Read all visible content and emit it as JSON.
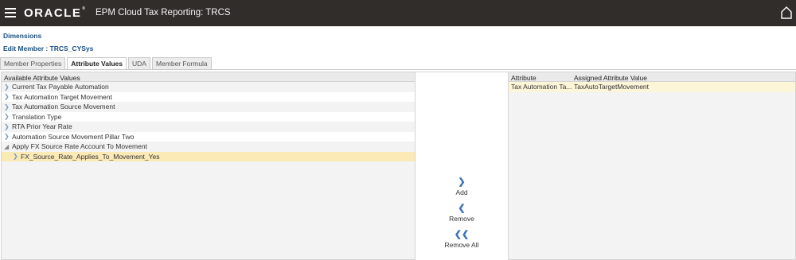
{
  "header": {
    "brand": "ORACLE",
    "app_title": "EPM Cloud Tax Reporting: TRCS",
    "menu_icon": "hamburger-menu-icon",
    "home_icon": "home-icon"
  },
  "breadcrumb": "Dimensions",
  "edit_title": "Edit Member : TRCS_CYSys",
  "tabs": [
    {
      "label": "Member Properties",
      "active": false
    },
    {
      "label": "Attribute Values",
      "active": true
    },
    {
      "label": "UDA",
      "active": false
    },
    {
      "label": "Member Formula",
      "active": false
    }
  ],
  "available": {
    "header": "Available Attribute Values",
    "items": [
      {
        "label": "Current Tax Payable Automation",
        "state": "collapsed"
      },
      {
        "label": "Tax Automation Target Movement",
        "state": "collapsed"
      },
      {
        "label": "Tax Automation Source Movement",
        "state": "collapsed"
      },
      {
        "label": "Translation Type",
        "state": "collapsed"
      },
      {
        "label": "RTA Prior Year Rate",
        "state": "collapsed"
      },
      {
        "label": "Automation Source Movement Pillar Two",
        "state": "collapsed"
      },
      {
        "label": "Apply FX Source Rate Account To Movement",
        "state": "expanded"
      },
      {
        "label": "FX_Source_Rate_Applies_To_Movement_Yes",
        "state": "child-selected"
      }
    ]
  },
  "actions": {
    "add": "Add",
    "remove": "Remove",
    "remove_all": "Remove All"
  },
  "assigned": {
    "col_attribute": "Attribute",
    "col_value": "Assigned Attribute Value",
    "rows": [
      {
        "attribute": "Tax Automation Ta...",
        "value": "TaxAutoTargetMovement"
      }
    ]
  },
  "colors": {
    "topbar": "#312d2a",
    "link_blue": "#1a4e80",
    "selection": "#fbe9b6",
    "assigned_row": "#fdf5d8",
    "arrow_blue": "#3a73b8"
  }
}
